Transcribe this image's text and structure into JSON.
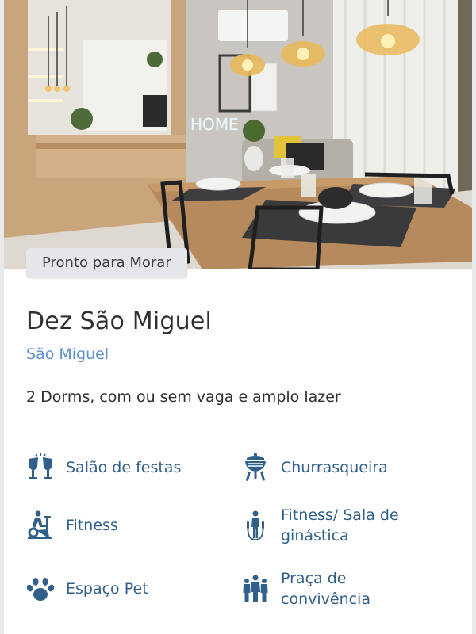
{
  "card": {
    "badge": "Pronto para Morar",
    "title": "Dez São Miguel",
    "neighborhood": "São Miguel",
    "description": "2 Dorms, com ou sem vaga e amplo lazer",
    "photo_sign": "HOME",
    "amenities": [
      {
        "label": "Salão de festas",
        "icon": "cheers-glasses-icon"
      },
      {
        "label": "Churrasqueira",
        "icon": "grill-icon"
      },
      {
        "label": "Fitness",
        "icon": "exercise-bike-icon"
      },
      {
        "label": "Fitness/ Sala de ginástica",
        "icon": "jump-rope-icon"
      },
      {
        "label": "Espaço Pet",
        "icon": "paw-icon"
      },
      {
        "label": "Praça de convivência",
        "icon": "people-group-icon"
      }
    ]
  },
  "colors": {
    "accent": "#2f5f8a",
    "link": "#5e8fc7",
    "text": "#2d2f33",
    "badge_bg": "#e4e6e9"
  }
}
